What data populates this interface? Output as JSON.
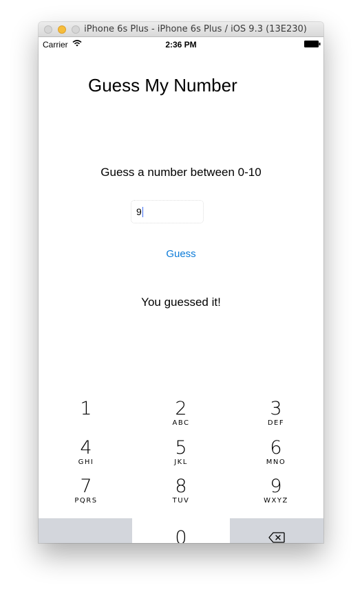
{
  "window": {
    "title": "iPhone 6s Plus - iPhone 6s Plus / iOS 9.3 (13E230)"
  },
  "statusbar": {
    "carrier": "Carrier",
    "time": "2:36 PM"
  },
  "app": {
    "title": "Guess My Number",
    "prompt": "Guess a number between 0-10",
    "input_value": "9",
    "guess_label": "Guess",
    "result": "You guessed it!"
  },
  "keypad": {
    "keys": [
      {
        "digit": "1",
        "letters": ""
      },
      {
        "digit": "2",
        "letters": "ABC"
      },
      {
        "digit": "3",
        "letters": "DEF"
      },
      {
        "digit": "4",
        "letters": "GHI"
      },
      {
        "digit": "5",
        "letters": "JKL"
      },
      {
        "digit": "6",
        "letters": "MNO"
      },
      {
        "digit": "7",
        "letters": "PQRS"
      },
      {
        "digit": "8",
        "letters": "TUV"
      },
      {
        "digit": "9",
        "letters": "WXYZ"
      },
      {
        "digit": "0",
        "letters": ""
      }
    ]
  },
  "colors": {
    "accent": "#0a7ad8",
    "keypad_special": "#d3d6dc",
    "traffic_yellow": "#f6bd3b"
  },
  "icons": {
    "wifi": "wifi-icon",
    "battery": "battery-icon",
    "delete": "delete-backspace-icon"
  }
}
